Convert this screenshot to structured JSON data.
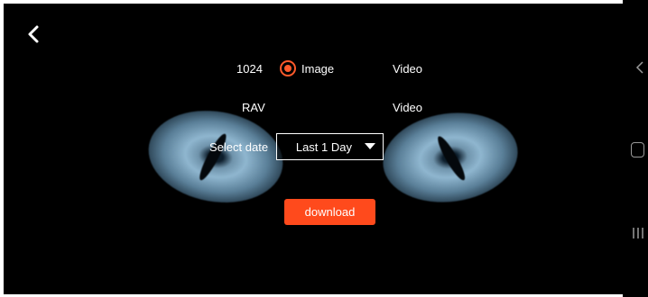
{
  "header": {
    "back_icon": "chevron-left-icon"
  },
  "options": {
    "row1": {
      "left_label": "1024",
      "image_label": "Image",
      "video_label": "Video",
      "selected": "Image"
    },
    "row2": {
      "left_label": "RAV",
      "video_label": "Video"
    }
  },
  "date": {
    "label": "Select date",
    "selected": "Last 1 Day"
  },
  "actions": {
    "download_label": "download"
  },
  "colors": {
    "accent": "#ff4a1c",
    "background": "#000000",
    "text": "#ffffff"
  },
  "system_nav": {
    "back_icon": "nav-back-icon",
    "home_icon": "nav-home-icon",
    "recent_icon": "nav-recent-icon"
  }
}
